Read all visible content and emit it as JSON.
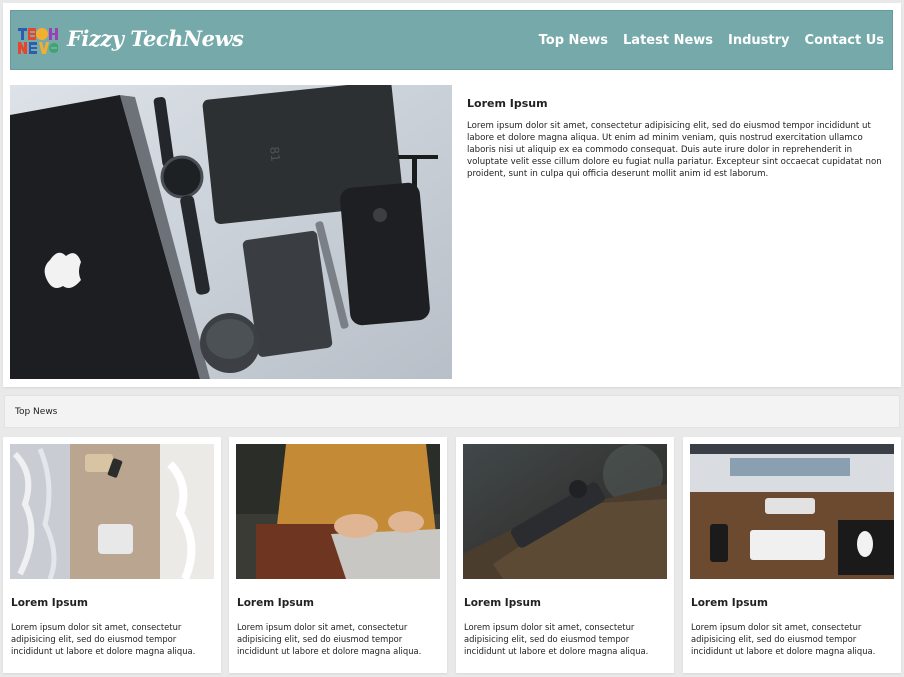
{
  "brand": {
    "logo_mark_text": "TECH NEWS",
    "name": "Fizzy TechNews"
  },
  "nav": {
    "items": [
      "Top News",
      "Latest News",
      "Industry",
      "Contact Us"
    ]
  },
  "hero": {
    "title": "Lorem Ipsum",
    "body": "Lorem ipsum dolor sit amet, consectetur adipisicing elit, sed do eiusmod tempor incididunt ut labore et dolore magna aliqua. Ut enim ad minim veniam, quis nostrud exercitation ullamco laboris nisi ut aliquip ex ea commodo consequat. Duis aute irure dolor in reprehenderit in voluptate velit esse cillum dolore eu fugiat nulla pariatur. Excepteur sint occaecat cupidatat non proident, sunt in culpa qui officia deserunt mollit anim id est laborum."
  },
  "section": {
    "title": "Top News"
  },
  "cards": [
    {
      "title": "Lorem Ipsum",
      "body": "Lorem ipsum dolor sit amet, consectetur adipisicing elit, sed do eiusmod tempor incididunt ut labore et dolore magna aliqua."
    },
    {
      "title": "Lorem Ipsum",
      "body": "Lorem ipsum dolor sit amet, consectetur adipisicing elit, sed do eiusmod tempor incididunt ut labore et dolore magna aliqua."
    },
    {
      "title": "Lorem Ipsum",
      "body": "Lorem ipsum dolor sit amet, consectetur adipisicing elit, sed do eiusmod tempor incididunt ut labore et dolore magna aliqua."
    },
    {
      "title": "Lorem Ipsum",
      "body": "Lorem ipsum dolor sit amet, consectetur adipisicing elit, sed do eiusmod tempor incididunt ut labore et dolore magna aliqua."
    }
  ],
  "colors": {
    "header_bg": "#76a9a9",
    "page_bg": "#e9e9e9",
    "card_bg": "#ffffff"
  }
}
